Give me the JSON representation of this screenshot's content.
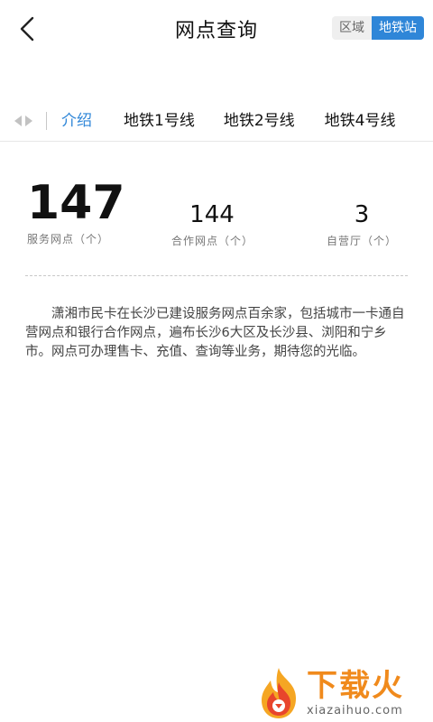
{
  "header": {
    "title": "网点查询",
    "segment": {
      "options": [
        "区域",
        "地铁站"
      ],
      "selected": "地铁站"
    }
  },
  "tabs": {
    "items": [
      {
        "label": "介绍",
        "active": true
      },
      {
        "label": "地铁1号线",
        "active": false
      },
      {
        "label": "地铁2号线",
        "active": false
      },
      {
        "label": "地铁4号线",
        "active": false
      }
    ]
  },
  "stats": [
    {
      "value": "147",
      "label": "服务网点（个）"
    },
    {
      "value": "144",
      "label": "合作网点（个）"
    },
    {
      "value": "3",
      "label": "自营厅（个）"
    }
  ],
  "intro": {
    "text": "潇湘市民卡在长沙已建设服务网点百余家，包括城市一卡通自营网点和银行合作网点，遍布长沙6大区及长沙县、浏阳和宁乡市。网点可办理售卡、充值、查询等业务，期待您的光临。"
  },
  "watermark": {
    "brand": "下载火",
    "url": "xiazaihuo.com"
  },
  "colors": {
    "accent": "#2f86d8",
    "watermark": "#f08a1c"
  },
  "icons": {
    "back": "chevron-left-icon",
    "tab_scroll": "scroll-arrows-icon",
    "watermark": "flame-logo-icon"
  }
}
